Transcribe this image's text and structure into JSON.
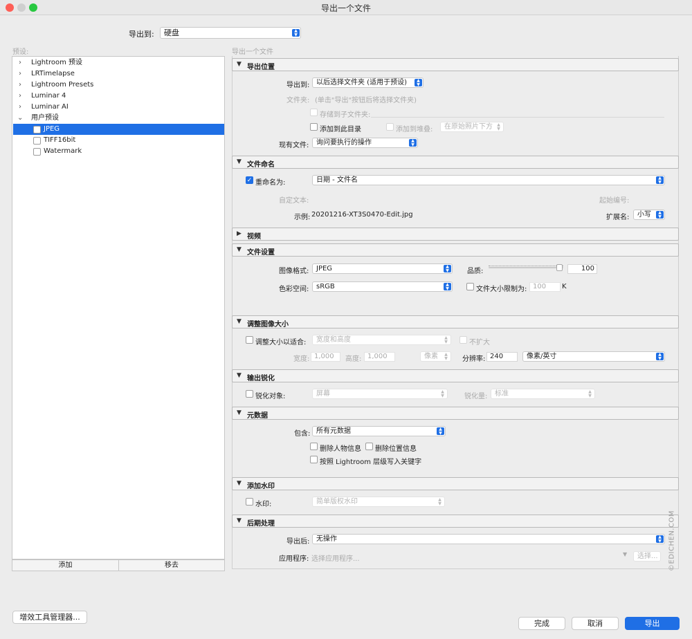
{
  "window": {
    "title": "导出一个文件"
  },
  "export_to": {
    "label": "导出到:",
    "value": "硬盘"
  },
  "presets": {
    "label": "预设:",
    "items": [
      {
        "label": "Lightroom 预设"
      },
      {
        "label": "LRTimelapse"
      },
      {
        "label": "Lightroom Presets"
      },
      {
        "label": "Luminar 4"
      },
      {
        "label": "Luminar AI"
      },
      {
        "label": "用户预设"
      },
      {
        "label": "JPEG"
      },
      {
        "label": "TIFF16bit"
      },
      {
        "label": "Watermark"
      }
    ],
    "add_label": "添加",
    "remove_label": "移去"
  },
  "breadcrumb": "导出一个文件",
  "sections": {
    "location": {
      "title": "导出位置",
      "export_to_label": "导出到:",
      "export_to_value": "以后选择文件夹 (适用于预设)",
      "folder_label": "文件夹:",
      "folder_value": "(单击\"导出\"按钮后将选择文件夹)",
      "subfolder_label": "存储到子文件夹:",
      "add_catalog_label": "添加到此目录",
      "add_stack_label": "添加到堆叠:",
      "stack_position": "在原始照片下方",
      "existing_label": "现有文件:",
      "existing_value": "询问要执行的操作"
    },
    "naming": {
      "title": "文件命名",
      "rename_label": "重命名为:",
      "rename_value": "日期 - 文件名",
      "custom_text_label": "自定文本:",
      "start_number_label": "起始编号:",
      "example_label": "示例:",
      "example_value": "20201216-XT3S0470-Edit.jpg",
      "extension_label": "扩展名:",
      "extension_value": "小写"
    },
    "video": {
      "title": "视频"
    },
    "file_settings": {
      "title": "文件设置",
      "format_label": "图像格式:",
      "format_value": "JPEG",
      "quality_label": "品质:",
      "quality_value": "100",
      "colorspace_label": "色彩空间:",
      "colorspace_value": "sRGB",
      "limit_label": "文件大小限制为:",
      "limit_value": "100",
      "limit_unit": "K"
    },
    "resize": {
      "title": "调整图像大小",
      "fit_label": "调整大小以适合:",
      "fit_value": "宽度和高度",
      "no_enlarge_label": "不扩大",
      "width_label": "宽度:",
      "width_value": "1,000",
      "height_label": "高度:",
      "height_value": "1,000",
      "unit_value": "像素",
      "resolution_label": "分辨率:",
      "resolution_value": "240",
      "resolution_unit": "像素/英寸"
    },
    "sharpen": {
      "title": "输出锐化",
      "sharpen_for_label": "锐化对象:",
      "sharpen_for_value": "屏幕",
      "amount_label": "锐化量:",
      "amount_value": "标准"
    },
    "metadata": {
      "title": "元数据",
      "include_label": "包含:",
      "include_value": "所有元数据",
      "remove_person_label": "删除人物信息",
      "remove_location_label": "删除位置信息",
      "keywords_label": "按照 Lightroom 层级写入关键字"
    },
    "watermark": {
      "title": "添加水印",
      "watermark_label": "水印:",
      "watermark_value": "简单版权水印"
    },
    "post": {
      "title": "后期处理",
      "after_label": "导出后:",
      "after_value": "无操作",
      "app_label": "应用程序:",
      "app_placeholder": "选择应用程序...",
      "choose_label": "选择..."
    }
  },
  "footer": {
    "plugin_manager_label": "增效工具管理器...",
    "done_label": "完成",
    "cancel_label": "取消",
    "export_label": "导出"
  },
  "watermark_text": "©EDICHEN.COM"
}
